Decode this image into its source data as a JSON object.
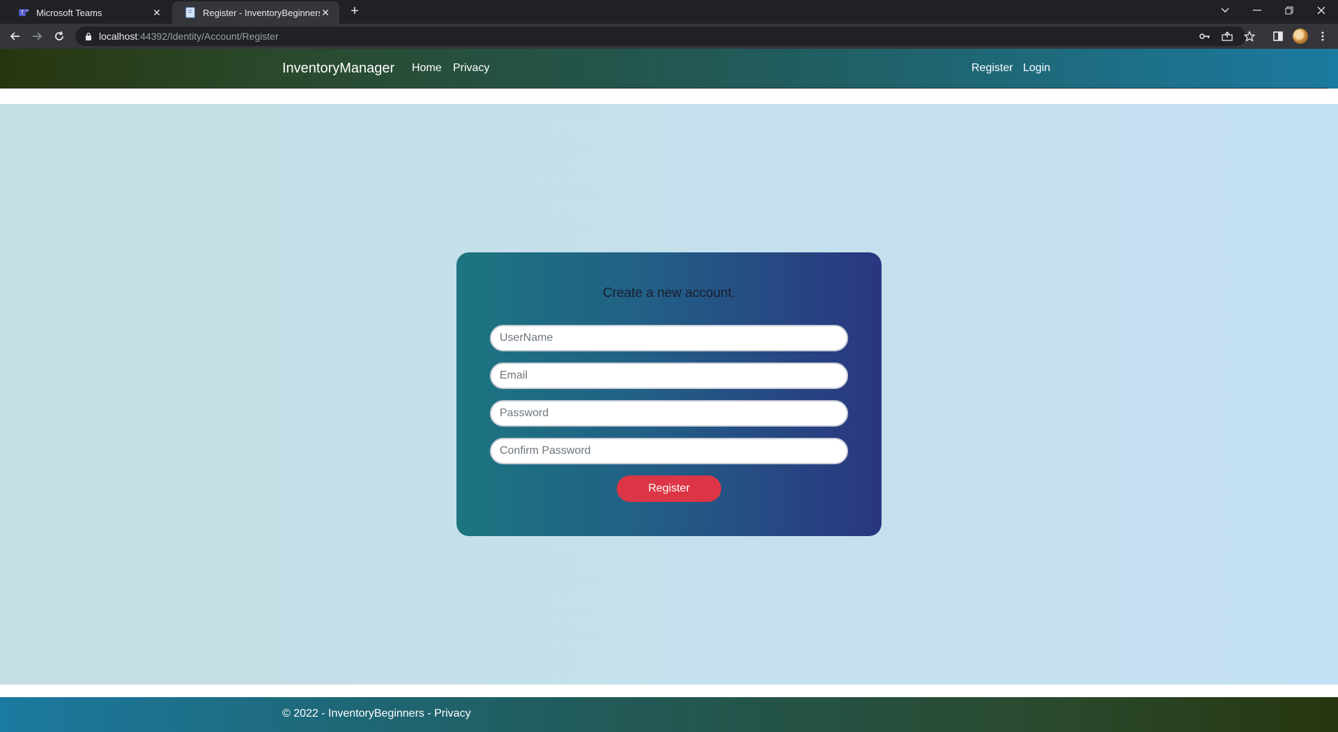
{
  "browser": {
    "tabs": [
      {
        "label": "Microsoft Teams",
        "active": false,
        "icon": "teams-icon"
      },
      {
        "label": "Register - InventoryBeginners",
        "active": true,
        "icon": "page-icon"
      }
    ],
    "url_host": "localhost",
    "url_rest": ":44392/Identity/Account/Register"
  },
  "site": {
    "brand": "InventoryManager",
    "nav_left": [
      "Home",
      "Privacy"
    ],
    "nav_right": [
      "Register",
      "Login"
    ]
  },
  "form": {
    "title": "Create a new account.",
    "username_placeholder": "UserName",
    "email_placeholder": "Email",
    "password_placeholder": "Password",
    "confirm_placeholder": "Confirm Password",
    "submit_label": "Register",
    "submit_color": "#dc3545"
  },
  "footer": {
    "prefix": "© 2022 - InventoryBeginners - ",
    "privacy_link": "Privacy"
  }
}
